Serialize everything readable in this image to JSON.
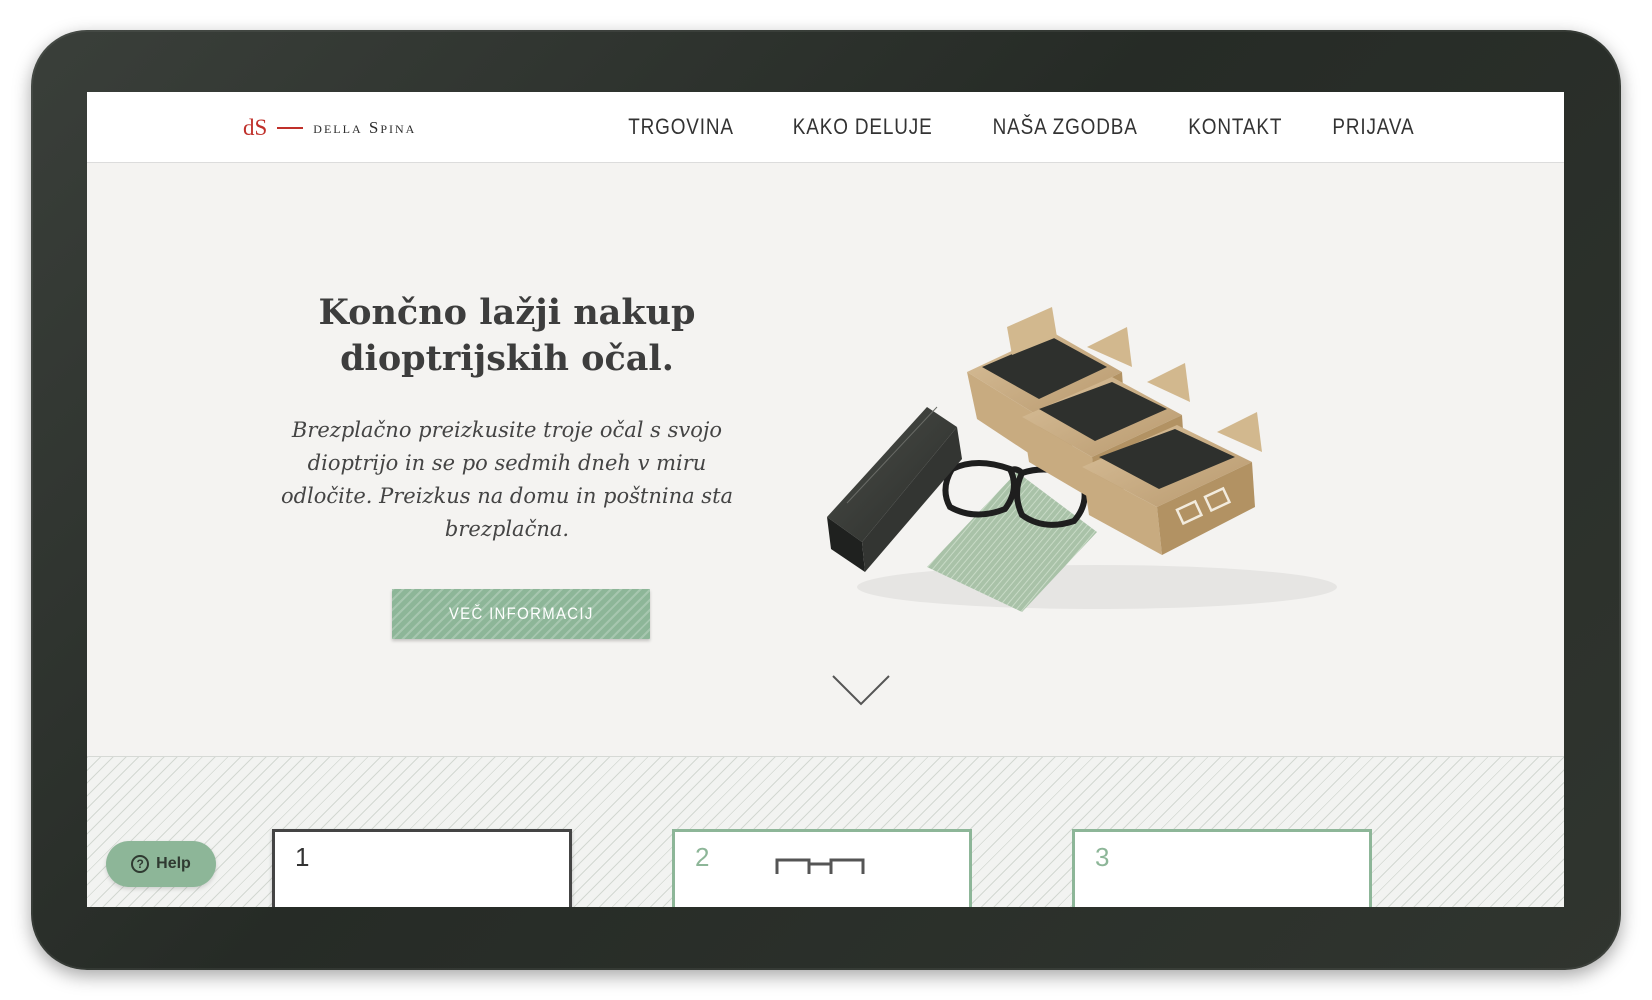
{
  "header": {
    "logo_mark": "dS",
    "logo_name": "della Spina",
    "nav": [
      {
        "label": "TRGOVINA"
      },
      {
        "label": "KAKO DELUJE"
      },
      {
        "label": "NAŠA ZGODBA"
      },
      {
        "label": "KONTAKT"
      },
      {
        "label": "PRIJAVA"
      }
    ]
  },
  "hero": {
    "title": "Končno lažji nakup dioptrijskih očal.",
    "text": "Brezplačno preizkusite troje očal s svojo dioptrijo in se po sedmih dneh v miru odločite. Preizkus na domu in poštnina sta brezplačna.",
    "cta_label": "VEČ INFORMACIJ"
  },
  "steps": [
    {
      "number": "1"
    },
    {
      "number": "2"
    },
    {
      "number": "3"
    }
  ],
  "help": {
    "label": "Help",
    "icon": "?"
  },
  "colors": {
    "accent_green": "#8db698",
    "logo_red": "#c0302a",
    "text_dark": "#3d3d3d",
    "hero_bg": "#f4f3f1"
  }
}
